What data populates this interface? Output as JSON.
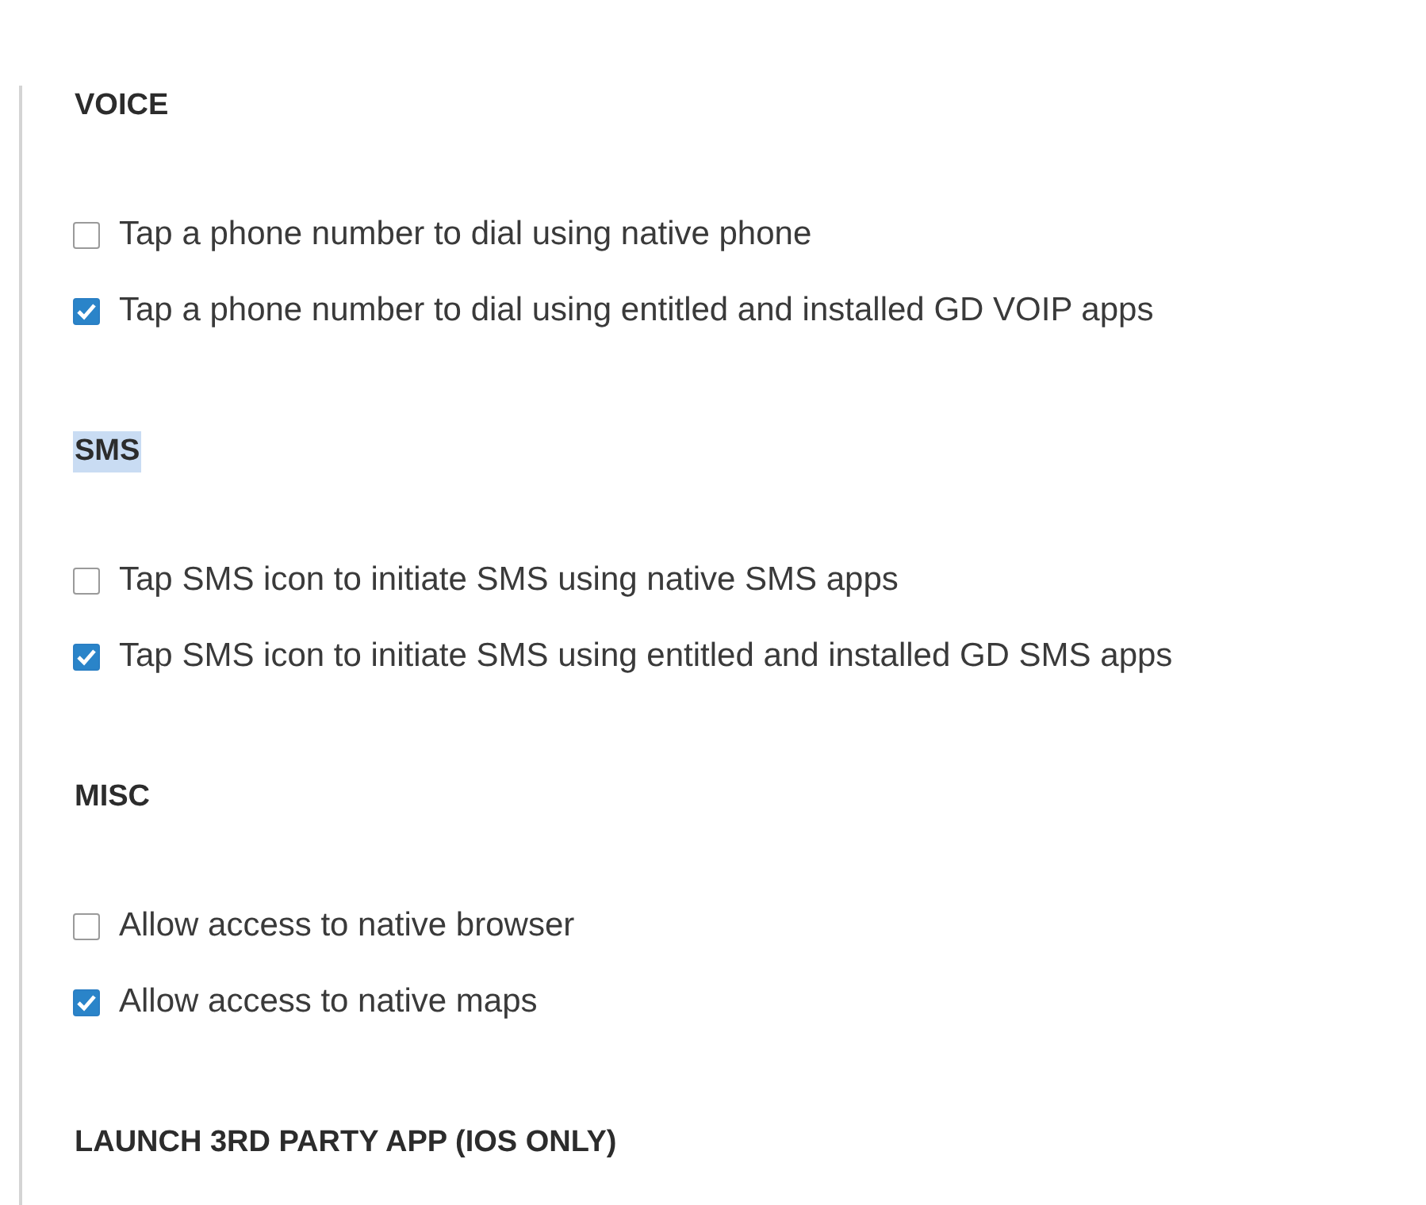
{
  "sections": [
    {
      "title": "VOICE",
      "highlighted": false,
      "options": [
        {
          "label": "Tap a phone number to dial using native phone",
          "checked": false
        },
        {
          "label": "Tap a phone number to dial using entitled and installed GD VOIP apps",
          "checked": true
        }
      ]
    },
    {
      "title": "SMS",
      "highlighted": true,
      "options": [
        {
          "label": "Tap SMS icon to initiate SMS using native SMS apps",
          "checked": false
        },
        {
          "label": "Tap SMS icon to initiate SMS using entitled and installed GD SMS apps",
          "checked": true
        }
      ]
    },
    {
      "title": "MISC",
      "highlighted": false,
      "options": [
        {
          "label": "Allow access to native browser",
          "checked": false
        },
        {
          "label": "Allow access to native maps",
          "checked": true
        }
      ]
    },
    {
      "title": "LAUNCH 3RD PARTY APP (IOS ONLY)",
      "highlighted": false
    }
  ]
}
